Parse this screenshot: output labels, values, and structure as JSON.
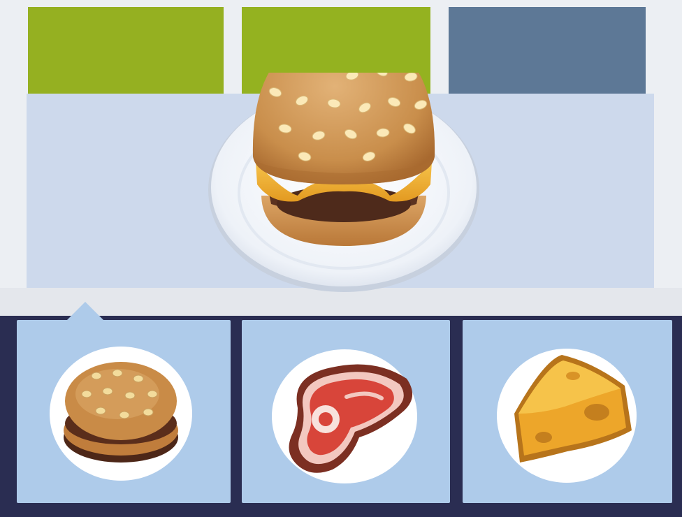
{
  "colors": {
    "tile_1": "#95b021",
    "tile_2": "#94b220",
    "tile_3": "#5d7896",
    "stage": "#cdd9ec",
    "tray": "#2a2d52",
    "slot": "#aecbea"
  },
  "order": {
    "dish_icon": "burger-on-plate-icon"
  },
  "ingredients": [
    {
      "icon": "bun-with-patty-icon",
      "selected": true
    },
    {
      "icon": "steak-icon",
      "selected": false
    },
    {
      "icon": "cheese-wedge-icon",
      "selected": false
    }
  ]
}
